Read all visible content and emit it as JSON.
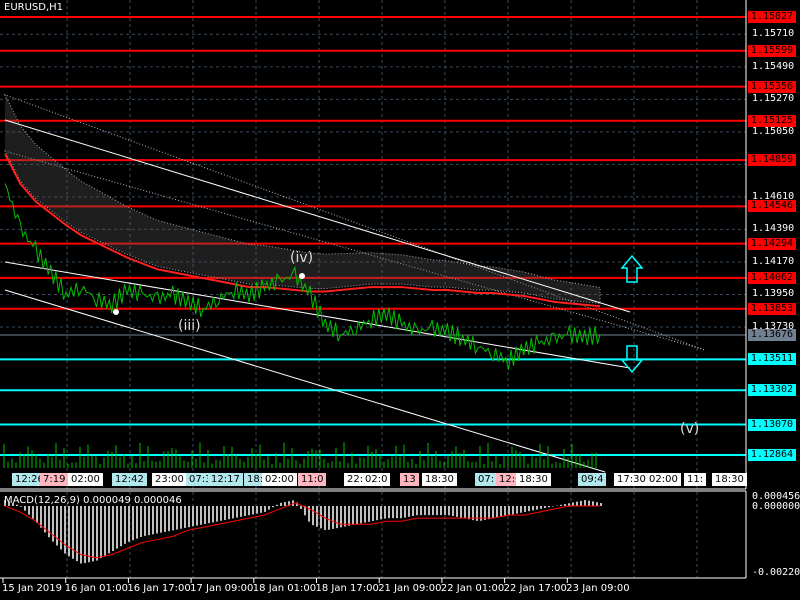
{
  "header": {
    "symbol_title": "EURUSD,H1"
  },
  "colors": {
    "resistance": "#ff0000",
    "support": "#00ffff",
    "current": "#708090",
    "price_line": "#00c000",
    "ma": "#ff2020",
    "background": "#000000"
  },
  "price_axis": {
    "ticks": [
      "1.15710",
      "1.15490",
      "1.15270",
      "1.15050",
      "1.14830",
      "1.14610",
      "1.14390",
      "1.14170",
      "1.13950",
      "1.13730"
    ],
    "resistance_levels": [
      "1.15827",
      "1.15599",
      "1.15356",
      "1.15125",
      "1.14859",
      "1.14546",
      "1.14294",
      "1.14062",
      "1.13853"
    ],
    "support_levels": [
      "1.13511",
      "1.13302",
      "1.13070",
      "1.12864"
    ],
    "current_price": "1.13676"
  },
  "time_axis": [
    "15 Jan 2019",
    "16 Jan 01:00",
    "16 Jan 17:00",
    "17 Jan 09:00",
    "18 Jan 01:00",
    "18 Jan 17:00",
    "21 Jan 09:00",
    "22 Jan 01:00",
    "22 Jan 17:00",
    "23 Jan 09:00"
  ],
  "session_tags": [
    {
      "text": "12:26",
      "color": "#b0e8ee"
    },
    {
      "text": "7:19",
      "color": "#ffb6c1"
    },
    {
      "text": "02:00",
      "color": "#ffffff"
    },
    {
      "text": "12:42",
      "color": "#b0e8ee"
    },
    {
      "text": "23:00",
      "color": "#ffffff"
    },
    {
      "text": "07:3",
      "color": "#b0e8ee"
    },
    {
      "text": "12:17",
      "color": "#b0e8ee"
    },
    {
      "text": "18:30",
      "color": "#b0e8ee"
    },
    {
      "text": "02:00",
      "color": "#ffffff"
    },
    {
      "text": "11:0",
      "color": "#ffb6c1"
    },
    {
      "text": "22:",
      "color": "#ffffff"
    },
    {
      "text": "02:0",
      "color": "#ffffff"
    },
    {
      "text": "13",
      "color": "#ffb6c1"
    },
    {
      "text": "18:30",
      "color": "#ffffff"
    },
    {
      "text": "07:",
      "color": "#b0e8ee"
    },
    {
      "text": "12:0",
      "color": "#ffb6c1"
    },
    {
      "text": "18:30",
      "color": "#ffffff"
    },
    {
      "text": "09:4",
      "color": "#b0e8ee"
    },
    {
      "text": "17:30",
      "color": "#ffffff"
    },
    {
      "text": "02:00",
      "color": "#ffffff"
    },
    {
      "text": "11:",
      "color": "#ffffff"
    },
    {
      "text": "18:30",
      "color": "#ffffff"
    }
  ],
  "waves": {
    "iii": "(iii)",
    "iv": "(iv)",
    "v": "(v)"
  },
  "macd": {
    "title": "MACD(12,26,9) 0.000049 0.000046",
    "ticks": [
      "0.000456",
      "0.000000",
      "-0.002204"
    ]
  },
  "chart_data": {
    "type": "line",
    "title": "EURUSD,H1",
    "ylim": [
      1.127,
      1.1594
    ],
    "price": [
      1.147,
      1.144,
      1.1425,
      1.141,
      1.1395,
      1.14,
      1.1392,
      1.1388,
      1.1398,
      1.1395,
      1.1392,
      1.1395,
      1.139,
      1.1385,
      1.1392,
      1.1398,
      1.1395,
      1.14,
      1.1404,
      1.1408,
      1.1395,
      1.1375,
      1.1368,
      1.1372,
      1.1378,
      1.1382,
      1.1375,
      1.137,
      1.1372,
      1.137,
      1.1365,
      1.136,
      1.1355,
      1.135,
      1.1358,
      1.1362,
      1.1365,
      1.1368,
      1.1366,
      1.1368
    ],
    "moving_average": [
      1.149,
      1.147,
      1.1458,
      1.145,
      1.1442,
      1.1435,
      1.143,
      1.1425,
      1.142,
      1.1416,
      1.1412,
      1.141,
      1.1408,
      1.1406,
      1.1404,
      1.1402,
      1.14,
      1.14,
      1.1399,
      1.1398,
      1.1397,
      1.1397,
      1.1398,
      1.1399,
      1.14,
      1.14,
      1.14,
      1.1399,
      1.1398,
      1.1398,
      1.1397,
      1.1396,
      1.1396,
      1.1395,
      1.1394,
      1.1392,
      1.139,
      1.1389,
      1.1388,
      1.1387
    ],
    "macd_hist": [
      0.0002,
      0.0,
      -0.0005,
      -0.0011,
      -0.0016,
      -0.0019,
      -0.0018,
      -0.0015,
      -0.0012,
      -0.001,
      -0.0009,
      -0.0008,
      -0.0007,
      -0.0006,
      -0.0005,
      -0.0004,
      -0.0003,
      -0.0002,
      0.0001,
      0.0002,
      -0.0006,
      -0.0008,
      -0.0007,
      -0.0006,
      -0.0005,
      -0.0004,
      -0.0004,
      -0.0003,
      -0.0003,
      -0.0003,
      -0.0004,
      -0.0005,
      -0.0004,
      -0.0003,
      -0.0002,
      -0.0001,
      0.0,
      0.0001,
      0.0002,
      0.0001
    ],
    "macd_signal": [
      0.0,
      -0.0002,
      -0.0005,
      -0.0009,
      -0.0013,
      -0.0016,
      -0.0017,
      -0.0016,
      -0.0014,
      -0.0012,
      -0.0011,
      -0.001,
      -0.0008,
      -0.0007,
      -0.0006,
      -0.0005,
      -0.0004,
      -0.0003,
      -0.0001,
      0.0001,
      -0.0001,
      -0.0004,
      -0.0006,
      -0.0006,
      -0.0006,
      -0.0005,
      -0.0005,
      -0.0004,
      -0.0004,
      -0.0004,
      -0.0004,
      -0.0004,
      -0.0004,
      -0.0003,
      -0.0003,
      -0.0002,
      -0.0001,
      0.0,
      0.0,
      0.0
    ],
    "macd_ylim": [
      -0.002204,
      0.000456
    ]
  }
}
